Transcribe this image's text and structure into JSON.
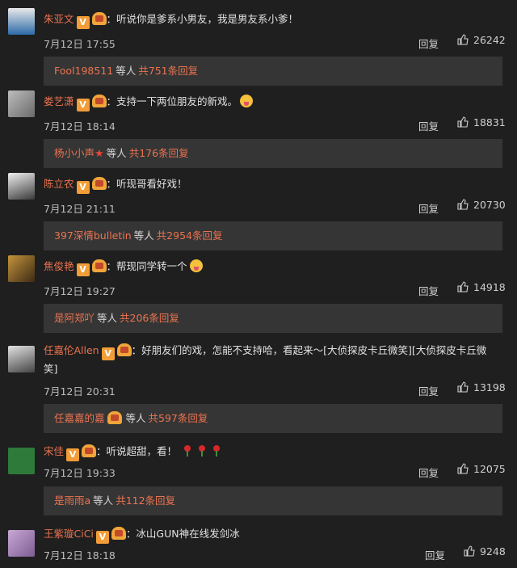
{
  "comments": [
    {
      "user": "朱亚文",
      "text": "：听说你是爹系小男友，我是男友系小爹！",
      "date": "7月12日 17:55",
      "reply_label": "回复",
      "likes": "26242",
      "reply": {
        "names": "Fool198511",
        "mid": "等人",
        "count": "共751条回复"
      }
    },
    {
      "user": "娄艺潇",
      "text": "：支持一下两位朋友的新戏。",
      "date": "7月12日 18:14",
      "reply_label": "回复",
      "likes": "18831",
      "reply": {
        "names": "杨小小声",
        "mid": "等人",
        "count": "共176条回复"
      }
    },
    {
      "user": "陈立农",
      "text": "：听现哥看好戏！",
      "date": "7月12日 21:11",
      "reply_label": "回复",
      "likes": "20730",
      "reply": {
        "names": "397深情bulletin",
        "mid": "等人",
        "count": "共2954条回复"
      }
    },
    {
      "user": "焦俊艳",
      "text": "：帮现同学转一个",
      "date": "7月12日 19:27",
      "reply_label": "回复",
      "likes": "14918",
      "reply": {
        "names": "是阿郑吖",
        "mid": "等人",
        "count": "共206条回复"
      }
    },
    {
      "user": "任嘉伦Allen",
      "text": "：好朋友们的戏，怎能不支持哈，看起来～[大侦探皮卡丘微笑][大侦探皮卡丘微",
      "text2": "笑]",
      "date": "7月12日 20:31",
      "reply_label": "回复",
      "likes": "13198",
      "reply": {
        "names": "任嘉嘉的嘉",
        "mid": "等人",
        "count": "共597条回复"
      }
    },
    {
      "user": "宋佳",
      "text": "：听说超甜，看！",
      "date": "7月12日 19:33",
      "reply_label": "回复",
      "likes": "12075",
      "reply": {
        "names": "是雨雨a",
        "mid": "等人",
        "count": "共112条回复"
      }
    },
    {
      "user": "王紫璇CiCi",
      "text": "：冰山GUN神在线发剑冰",
      "date": "7月12日 18:18",
      "reply_label": "回复",
      "likes": "9248"
    }
  ],
  "badges": {
    "v": "V"
  }
}
